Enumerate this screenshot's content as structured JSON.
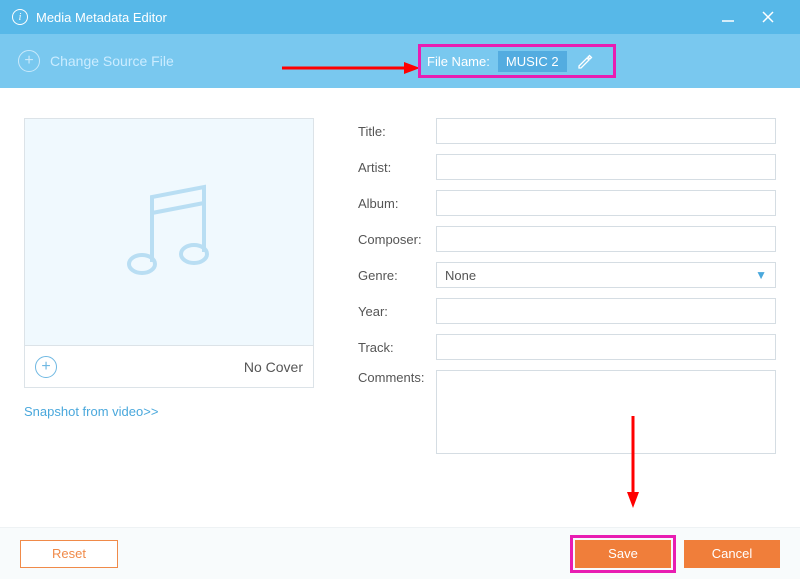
{
  "window": {
    "title": "Media Metadata Editor"
  },
  "toolbar": {
    "change_source": "Change Source File"
  },
  "filename_field": {
    "label": "File Name:",
    "value": "MUSIC 2"
  },
  "cover": {
    "no_cover": "No Cover",
    "snapshot_link": "Snapshot from video>>"
  },
  "fields": {
    "title_label": "Title:",
    "title_value": "",
    "artist_label": "Artist:",
    "artist_value": "",
    "album_label": "Album:",
    "album_value": "",
    "composer_label": "Composer:",
    "composer_value": "",
    "genre_label": "Genre:",
    "genre_value": "None",
    "year_label": "Year:",
    "year_value": "",
    "track_label": "Track:",
    "track_value": "",
    "comments_label": "Comments:",
    "comments_value": ""
  },
  "footer": {
    "reset": "Reset",
    "save": "Save",
    "cancel": "Cancel"
  }
}
